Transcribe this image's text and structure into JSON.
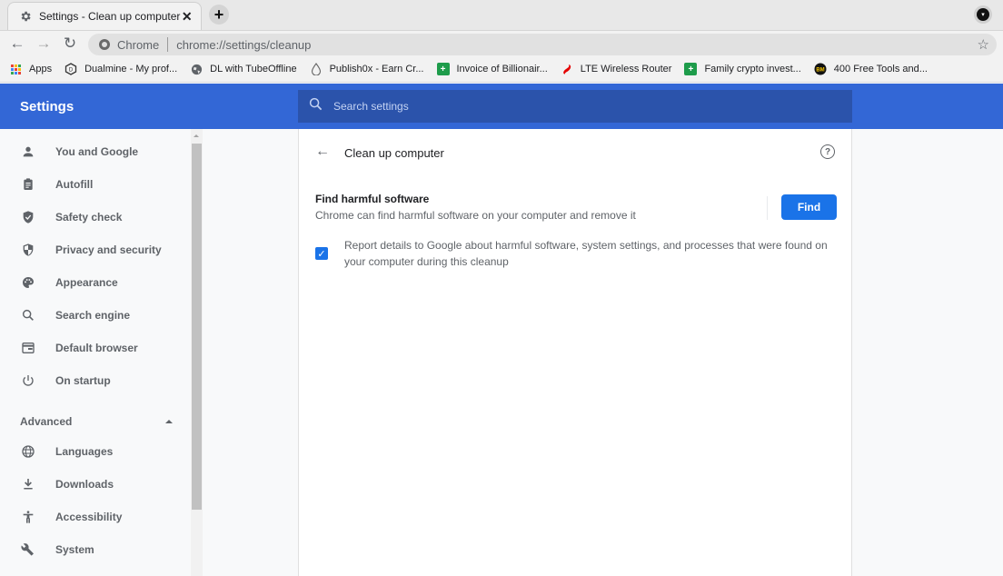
{
  "browser": {
    "tab": {
      "title": "Settings - Clean up computer",
      "icon": "gear-icon",
      "close_glyph": "✕"
    },
    "new_tab_glyph": "+",
    "profile_glyph": "▾",
    "nav": {
      "back": "←",
      "forward": "→",
      "reload": "↻"
    },
    "omnibox": {
      "chip": "Chrome",
      "url": "chrome://settings/cleanup",
      "star": "☆"
    },
    "bookmarks": [
      {
        "label": "Apps",
        "icon": "apps-grid-icon"
      },
      {
        "label": "Dualmine - My prof...",
        "icon": "dualmine-icon"
      },
      {
        "label": "DL with TubeOffline",
        "icon": "globe-icon"
      },
      {
        "label": "Publish0x - Earn Cr...",
        "icon": "drop-icon"
      },
      {
        "label": "Invoice of Billionair...",
        "icon": "sheets-icon"
      },
      {
        "label": "LTE Wireless Router",
        "icon": "airtel-icon"
      },
      {
        "label": "Family crypto invest...",
        "icon": "sheets-icon"
      },
      {
        "label": "400 Free Tools and...",
        "icon": "bm-logo-icon"
      }
    ]
  },
  "header": {
    "title": "Settings",
    "search_placeholder": "Search settings"
  },
  "sidebar": {
    "items": [
      {
        "label": "You and Google",
        "icon": "person-icon"
      },
      {
        "label": "Autofill",
        "icon": "clipboard-icon"
      },
      {
        "label": "Safety check",
        "icon": "shield-check-icon"
      },
      {
        "label": "Privacy and security",
        "icon": "shield-half-icon"
      },
      {
        "label": "Appearance",
        "icon": "palette-icon"
      },
      {
        "label": "Search engine",
        "icon": "search-icon"
      },
      {
        "label": "Default browser",
        "icon": "browser-window-icon"
      },
      {
        "label": "On startup",
        "icon": "power-icon"
      }
    ],
    "advanced_label": "Advanced",
    "advanced_items": [
      {
        "label": "Languages",
        "icon": "globe-icon"
      },
      {
        "label": "Downloads",
        "icon": "download-icon"
      },
      {
        "label": "Accessibility",
        "icon": "accessibility-icon"
      },
      {
        "label": "System",
        "icon": "wrench-icon"
      }
    ]
  },
  "page": {
    "back_glyph": "←",
    "title": "Clean up computer",
    "help_glyph": "?",
    "section_title": "Find harmful software",
    "section_desc": "Chrome can find harmful software on your computer and remove it",
    "find_button": "Find",
    "report_checked": true,
    "check_glyph": "✓",
    "report_label": "Report details to Google about harmful software, system settings, and processes that were found on your computer during this cleanup"
  },
  "colors": {
    "header_blue": "#3367d6",
    "search_blue": "#2b53ab",
    "button_blue": "#1a73e8"
  }
}
